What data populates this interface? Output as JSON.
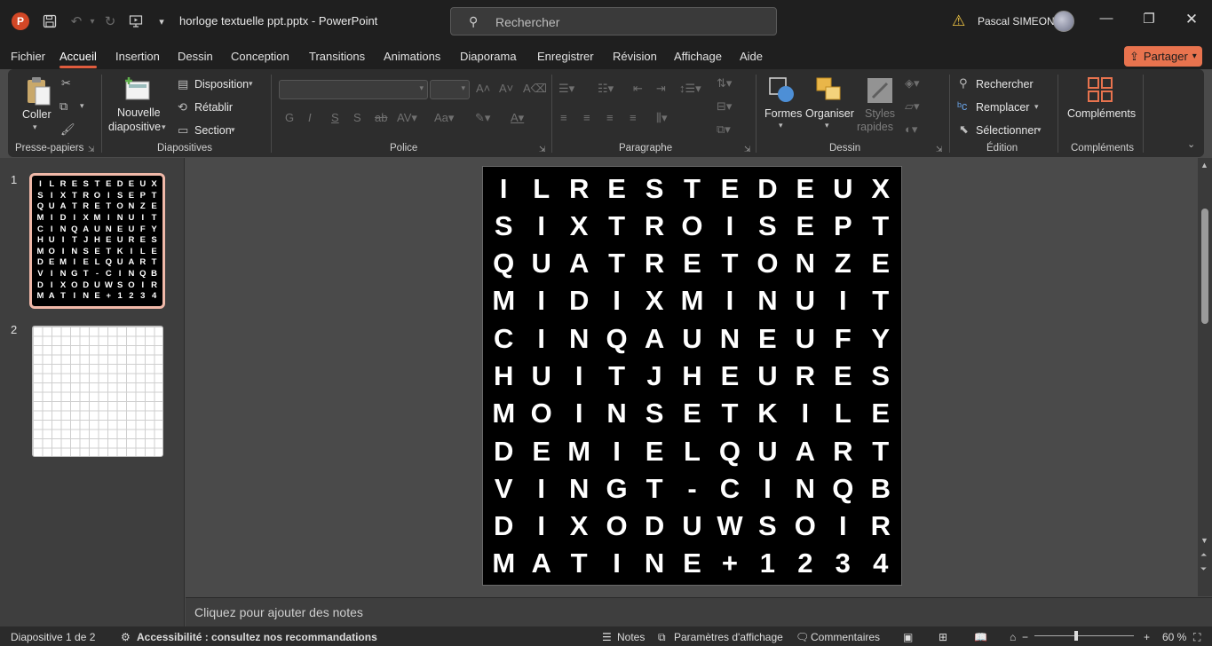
{
  "titlebar": {
    "logo_letter": "P",
    "doc_title": "horloge textuelle ppt.pptx  -  PowerPoint",
    "search_placeholder": "Rechercher",
    "user_name": "Pascal SIMEON",
    "accent_color": "#d24726"
  },
  "menu": {
    "items": [
      "Fichier",
      "Accueil",
      "Insertion",
      "Dessin",
      "Conception",
      "Transitions",
      "Animations",
      "Diaporama",
      "Enregistrer",
      "Révision",
      "Affichage",
      "Aide"
    ],
    "active": "Accueil",
    "share_label": "Partager"
  },
  "ribbon": {
    "clipboard": {
      "paste": "Coller",
      "label": "Presse-papiers"
    },
    "slides": {
      "new_slide_1": "Nouvelle",
      "new_slide_2": "diapositive",
      "layout": "Disposition",
      "reset": "Rétablir",
      "section": "Section",
      "label": "Diapositives"
    },
    "font": {
      "bold": "G",
      "italic": "I",
      "underline": "S",
      "shadow": "S",
      "label": "Police"
    },
    "paragraph": {
      "label": "Paragraphe"
    },
    "drawing": {
      "shapes": "Formes",
      "arrange": "Organiser",
      "styles_1": "Styles",
      "styles_2": "rapides",
      "label": "Dessin"
    },
    "editing": {
      "find": "Rechercher",
      "replace": "Remplacer",
      "select": "Sélectionner",
      "label": "Édition"
    },
    "addins": {
      "button": "Compléments",
      "label": "Compléments"
    }
  },
  "slides_panel": {
    "slide1_number": "1",
    "slide2_number": "2"
  },
  "slide": {
    "rows": [
      "ILRESTEDEUX",
      "SIXTROISEPT",
      "QUATRETONZE",
      "MIDIXMINUIT",
      "CINQAUNEUFY",
      "HUITJHEURES",
      "MOINSETKILE",
      "DEMIELQUART",
      "VINGT-CINQB",
      "DIXODUWSOIR",
      "MATINE+1234"
    ]
  },
  "notes": {
    "placeholder": "Cliquez pour ajouter des notes"
  },
  "status": {
    "slide_info": "Diapositive 1 de 2",
    "accessibility": "Accessibilité : consultez nos recommandations",
    "notes": "Notes",
    "display_settings": "Paramètres d'affichage",
    "comments": "Commentaires",
    "zoom": "60 %"
  }
}
